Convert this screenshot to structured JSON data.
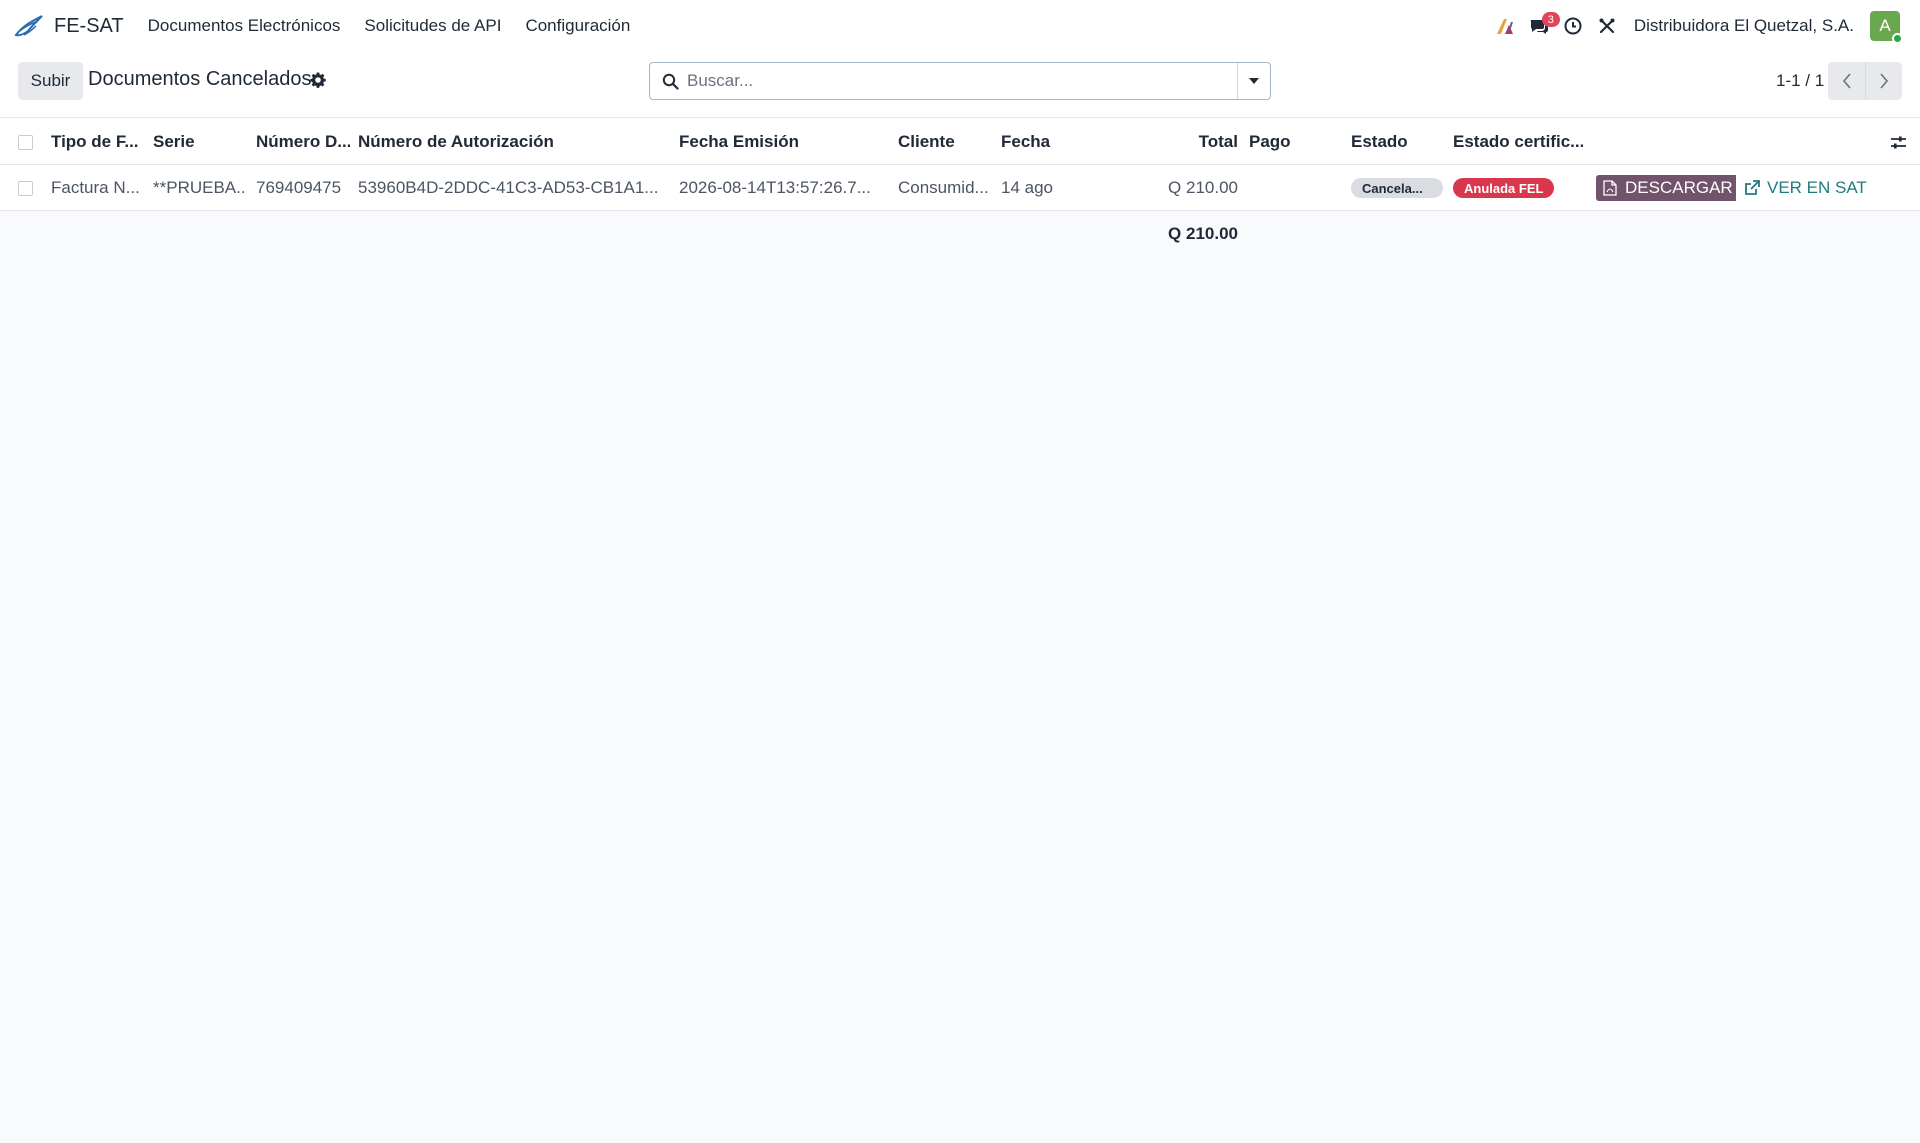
{
  "navbar": {
    "app_name": "FE-SAT",
    "menu": [
      {
        "label": "Documentos Electrónicos"
      },
      {
        "label": "Solicitudes de API"
      },
      {
        "label": "Configuración"
      }
    ],
    "messages_count": "3",
    "company": "Distribuidora El Quetzal, S.A.",
    "avatar_letter": "A"
  },
  "control": {
    "upload_label": "Subir",
    "title": "Documentos Cancelados",
    "search_placeholder": "Buscar...",
    "pager": "1-1 / 1"
  },
  "table": {
    "columns": [
      "Tipo de F...",
      "Serie",
      "Número D...",
      "Número de Autorización",
      "Fecha Emisión",
      "Cliente",
      "Fecha",
      "Total",
      "Pago",
      "Estado",
      "Estado certific..."
    ],
    "rows": [
      {
        "tipo": "Factura N...",
        "serie": "**PRUEBA...",
        "numero": "769409475",
        "autorizacion": "53960B4D-2DDC-41C3-AD53-CB1A1...",
        "fecha_emision": "2026-08-14T13:57:26.7...",
        "cliente": "Consumid...",
        "fecha": "14 ago",
        "total": "Q 210.00",
        "pago": "",
        "estado": "Cancela...",
        "estado_cert": "Anulada FEL",
        "download_label": "DESCARGAR",
        "sat_label": "VER EN SAT"
      }
    ],
    "sum_total": "Q 210.00"
  },
  "colors": {
    "brand": "#71536b",
    "danger": "#d9374e",
    "link": "#1f7b80"
  }
}
